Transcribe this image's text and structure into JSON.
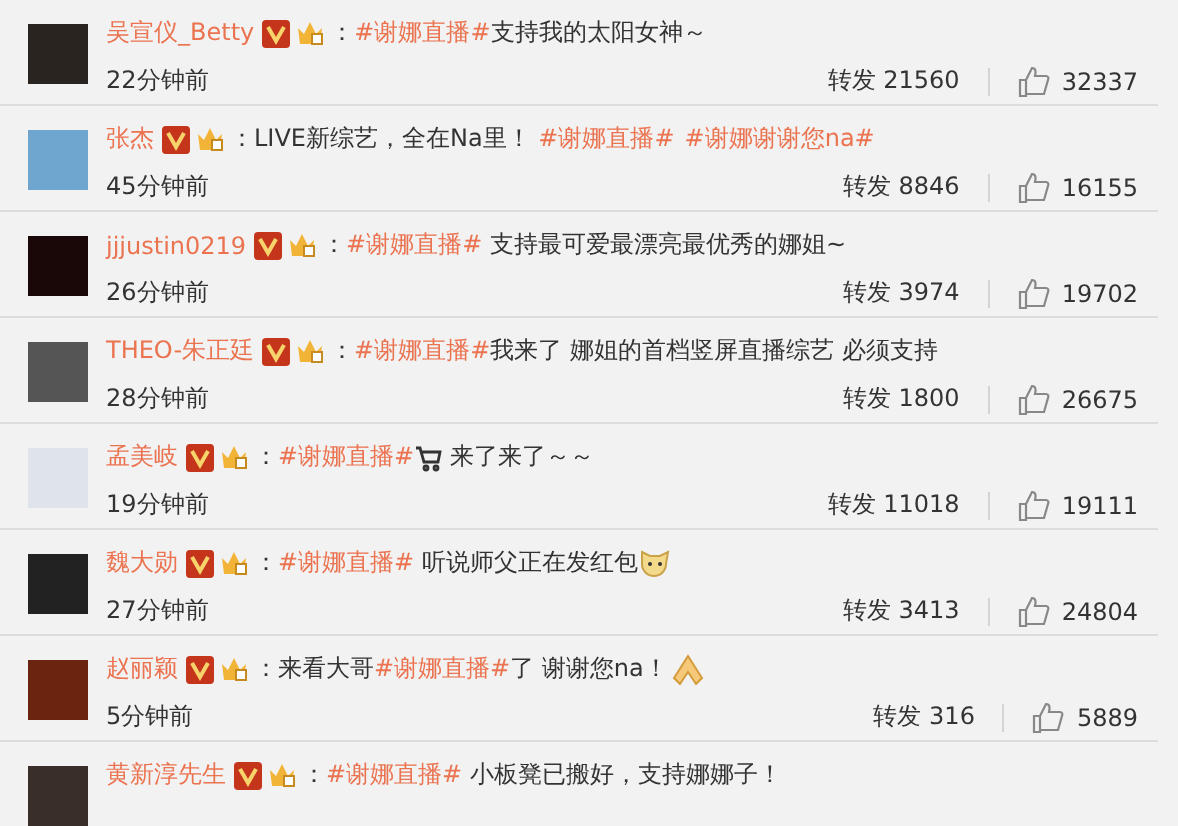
{
  "comments": [
    {
      "name": "吴宣仪_Betty",
      "content": [
        {
          "kind": "text",
          "text": "："
        },
        {
          "kind": "tag",
          "text": "#谢娜直播#"
        },
        {
          "kind": "text",
          "text": "支持我的太阳女神～"
        }
      ],
      "time": "22分钟前",
      "repost_label": "转发",
      "reposts": "21560",
      "likes": "32337"
    },
    {
      "name": "张杰",
      "content": [
        {
          "kind": "text",
          "text": "：LIVE新综艺，全在Na里！ "
        },
        {
          "kind": "tag",
          "text": "#谢娜直播#"
        },
        {
          "kind": "tag",
          "text": "#谢娜谢谢您na#"
        }
      ],
      "time": "45分钟前",
      "repost_label": "转发",
      "reposts": "8846",
      "likes": "16155"
    },
    {
      "name": "jjjustin0219",
      "content": [
        {
          "kind": "text",
          "text": "："
        },
        {
          "kind": "tag",
          "text": "#谢娜直播#"
        },
        {
          "kind": "text",
          "text": " 支持最可爱最漂亮最优秀的娜姐~"
        }
      ],
      "time": "26分钟前",
      "repost_label": "转发",
      "reposts": "3974",
      "likes": "19702"
    },
    {
      "name": "THEO-朱正廷",
      "content": [
        {
          "kind": "text",
          "text": "："
        },
        {
          "kind": "tag",
          "text": "#谢娜直播#"
        },
        {
          "kind": "text",
          "text": "我来了 娜姐的首档竖屏直播综艺 必须支持"
        }
      ],
      "time": "28分钟前",
      "repost_label": "转发",
      "reposts": "1800",
      "likes": "26675"
    },
    {
      "name": "孟美岐",
      "content": [
        {
          "kind": "text",
          "text": "："
        },
        {
          "kind": "tag",
          "text": "#谢娜直播#"
        },
        {
          "kind": "cart"
        },
        {
          "kind": "text",
          "text": " 来了来了～～"
        }
      ],
      "time": "19分钟前",
      "repost_label": "转发",
      "reposts": "11018",
      "likes": "19111"
    },
    {
      "name": "魏大勋",
      "content": [
        {
          "kind": "text",
          "text": "："
        },
        {
          "kind": "tag",
          "text": "#谢娜直播#"
        },
        {
          "kind": "text",
          "text": " 听说师父正在发红包"
        },
        {
          "kind": "dog"
        }
      ],
      "time": "27分钟前",
      "repost_label": "转发",
      "reposts": "3413",
      "likes": "24804"
    },
    {
      "name": "赵丽颖",
      "content": [
        {
          "kind": "text",
          "text": "：来看大哥"
        },
        {
          "kind": "tag",
          "text": "#谢娜直播#"
        },
        {
          "kind": "text",
          "text": "了 谢谢您na！"
        },
        {
          "kind": "hands"
        }
      ],
      "time": "5分钟前",
      "repost_label": "转发",
      "reposts": "316",
      "likes": "5889"
    },
    {
      "name": "黄新淳先生",
      "content": [
        {
          "kind": "text",
          "text": "："
        },
        {
          "kind": "tag",
          "text": "#谢娜直播#"
        },
        {
          "kind": "text",
          "text": " 小板凳已搬好，支持娜娜子！"
        }
      ]
    }
  ]
}
